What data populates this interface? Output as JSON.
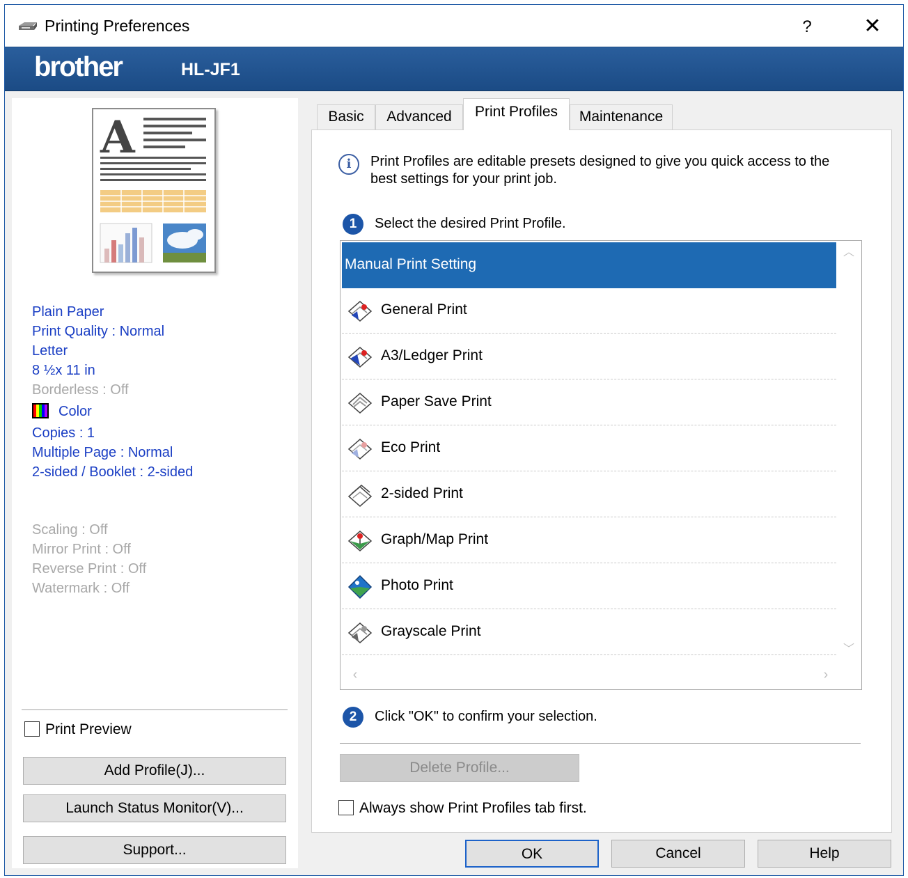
{
  "window": {
    "title": "Printing Preferences"
  },
  "titlebar": {
    "help_label": "?",
    "close_label": "✕"
  },
  "banner": {
    "brand": "brother",
    "model": "HL-JF1"
  },
  "summary": {
    "media_type": "Plain Paper",
    "print_quality": "Print Quality : Normal",
    "paper_size": "Letter",
    "paper_dims": "8 ½x 11 in",
    "borderless": "Borderless : Off",
    "color": "Color",
    "copies": "Copies : 1",
    "multiple_page": "Multiple Page : Normal",
    "two_sided": "2-sided / Booklet : 2-sided",
    "scaling": "Scaling : Off",
    "mirror_print": "Mirror Print : Off",
    "reverse_print": "Reverse Print : Off",
    "watermark": "Watermark : Off"
  },
  "left_actions": {
    "print_preview_label": "Print Preview",
    "print_preview_checked": false,
    "add_profile": "Add Profile(J)...",
    "launch_status_monitor": "Launch Status Monitor(V)...",
    "support": "Support..."
  },
  "tabs": [
    {
      "label": "Basic",
      "active": false
    },
    {
      "label": "Advanced",
      "active": false
    },
    {
      "label": "Print Profiles",
      "active": true
    },
    {
      "label": "Maintenance",
      "active": false
    }
  ],
  "print_profiles": {
    "info_text": "Print Profiles are editable presets designed to give you quick access to the best settings for your print job.",
    "step1_number": "1",
    "step1_text": "Select the desired Print Profile.",
    "items": [
      {
        "label": "Manual Print Setting",
        "selected": true,
        "icon": "none"
      },
      {
        "label": "General Print",
        "selected": false,
        "icon": "general-print-icon"
      },
      {
        "label": "A3/Ledger Print",
        "selected": false,
        "icon": "a3-ledger-print-icon"
      },
      {
        "label": "Paper Save Print",
        "selected": false,
        "icon": "paper-save-print-icon"
      },
      {
        "label": "Eco Print",
        "selected": false,
        "icon": "eco-print-icon"
      },
      {
        "label": "2-sided Print",
        "selected": false,
        "icon": "two-sided-print-icon"
      },
      {
        "label": "Graph/Map Print",
        "selected": false,
        "icon": "graph-map-print-icon"
      },
      {
        "label": "Photo Print",
        "selected": false,
        "icon": "photo-print-icon"
      },
      {
        "label": "Grayscale Print",
        "selected": false,
        "icon": "grayscale-print-icon"
      }
    ],
    "step2_number": "2",
    "step2_text": "Click \"OK\" to confirm your selection.",
    "delete_profile": "Delete Profile...",
    "always_show_label": "Always show Print Profiles tab first.",
    "always_show_checked": false
  },
  "dialog_buttons": {
    "ok": "OK",
    "cancel": "Cancel",
    "help": "Help"
  },
  "colors": {
    "accent": "#1e6ab3",
    "banner": "#1f5391",
    "summary_text": "#1a3ec4",
    "disabled_text": "#a8a8a8"
  }
}
